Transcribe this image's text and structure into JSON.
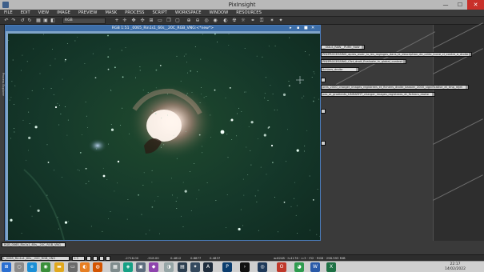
{
  "window": {
    "title": "PixInsight",
    "minimize_icon": "—",
    "maximize_icon": "☐",
    "close_icon": "✕"
  },
  "menu": [
    "FILE",
    "EDIT",
    "VIEW",
    "IMAGE",
    "PREVIEW",
    "MASK",
    "PROCESS",
    "SCRIPT",
    "WORKSPACE",
    "WINDOW",
    "RESOURCES"
  ],
  "toolbar": {
    "color_space": "RGB"
  },
  "image_window": {
    "title": "RGB 1:51 _0065_Rin1s1_60s__20C_RGB_VNG:<*new*>",
    "controls": [
      "▸",
      "▪",
      "■",
      "✕"
    ]
  },
  "side_panel": {
    "fields": [
      "__ODLS_RAW__PURE_RAW",
      "PREPROCESSING_apres_avoir_lu_les_reglages_dans_la_description_de_cette_icone_ci_contre_a_droite",
      "PREPROCESSING_Cfct_droit_Evaluate_in_global_context",
      "fichiers_droite",
      "",
      "pres_2000_charger_images_registrees_et_fichiers_droite_bassier_2000_significative_et_tmp_rejet",
      "pas_ai_gradients_LINEARFIT_charger_images_registrees_et_fichiers_droite",
      ""
    ]
  },
  "left_strip_label": "Process Explorer",
  "image_tabs": [
    "RGB_0065_Rin1s1_60s__20C_RGB_VNG"
  ],
  "status": {
    "image_name": "L_0065_Rin1s1_60s__20C_RGB_VNG",
    "zoom": "1:3",
    "x": "-2716.00",
    "y": "-918.00",
    "r": "0.4812",
    "g": "0.8877",
    "b": "0.4837",
    "info": "w:6248 · h:4176 · n:3 · f32 · RGB · 298.593 MiB"
  },
  "taskbar": {
    "time": "22:17",
    "date": "14/02/2022",
    "apps": [
      "windows-start",
      "search",
      "task-view",
      "edge",
      "file-explorer",
      "firefox",
      "chrome",
      "mail",
      "settings",
      "calculator",
      "camera",
      "paint",
      "photo",
      "disk",
      "pixinsight",
      "astro-tool",
      "photoshop",
      "cmd",
      "steam",
      "opera",
      "word",
      "excel"
    ]
  },
  "colors": {
    "accent": "#3d6ea8",
    "canvas_bg": "#163a2a",
    "nebula_core": "#fff4ea",
    "nebula_glow": "#d99a8c"
  }
}
